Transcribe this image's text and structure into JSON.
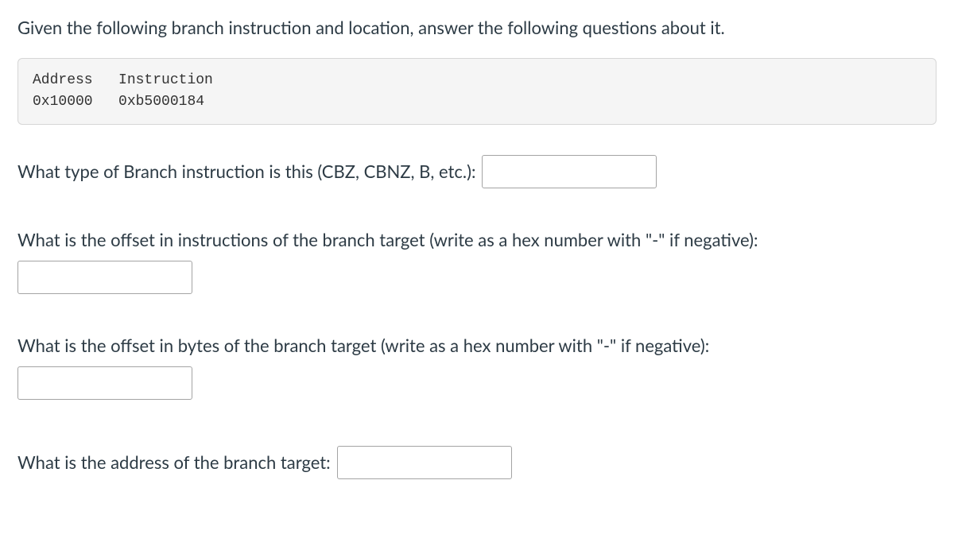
{
  "intro": "Given the following branch instruction and location, answer the following questions about it.",
  "code": {
    "header_address": "Address",
    "header_instruction": "Instruction",
    "row_address": "0x10000",
    "row_instruction": "0xb5000184"
  },
  "questions": {
    "q1_prompt": "What type of Branch instruction is this (CBZ, CBNZ, B, etc.):",
    "q2_prompt": "What is the offset in instructions of the branch target (write as a hex number with \"-\" if negative):",
    "q3_prompt": "What is the offset in bytes of the branch target (write as a hex number with \"-\" if negative):",
    "q4_prompt": "What is the address of the branch target:"
  },
  "answers": {
    "q1": "",
    "q2": "",
    "q3": "",
    "q4": ""
  }
}
